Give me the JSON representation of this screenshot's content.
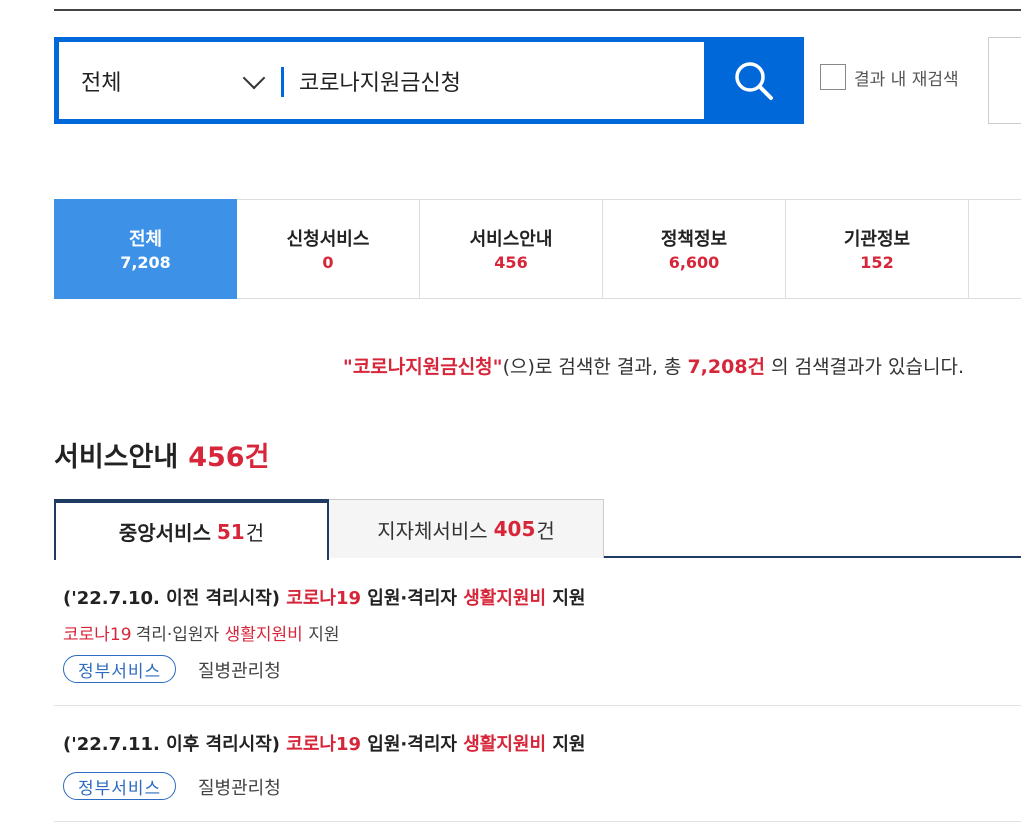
{
  "search": {
    "scope": "전체",
    "query": "코로나지원금신청",
    "research_label": "결과 내 재검색"
  },
  "categories": [
    {
      "label": "전체",
      "count": "7,208"
    },
    {
      "label": "신청서비스",
      "count": "0"
    },
    {
      "label": "서비스안내",
      "count": "456"
    },
    {
      "label": "정책정보",
      "count": "6,600"
    },
    {
      "label": "기관정보",
      "count": "152"
    }
  ],
  "summary": {
    "keyword": "\"코로나지원금신청\"",
    "text1": "(으)로 검색한 결과, 총",
    "total": "7,208건",
    "text2": "의 검색결과가 있습니다."
  },
  "section": {
    "title": "서비스안내",
    "count": "456건"
  },
  "subtabs": [
    {
      "label": "중앙서비스",
      "count": "51",
      "unit": "건"
    },
    {
      "label": "지자체서비스",
      "count": "405",
      "unit": "건"
    }
  ],
  "results": [
    {
      "title_pre": "('22.7.10. 이전 격리시작)",
      "title_hl1": "코로나19",
      "title_mid": "입원·격리자",
      "title_hl2": "생활지원비",
      "title_post": "지원",
      "desc_hl1": "코로나19",
      "desc_mid": "격리·입원자",
      "desc_hl2": "생활지원비",
      "desc_post": "지원",
      "badge": "정부서비스",
      "agency": "질병관리청"
    },
    {
      "title_pre": "('22.7.11. 이후 격리시작)",
      "title_hl1": "코로나19",
      "title_mid": "입원·격리자",
      "title_hl2": "생활지원비",
      "title_post": "지원",
      "badge": "정부서비스",
      "agency": "질병관리청"
    }
  ]
}
